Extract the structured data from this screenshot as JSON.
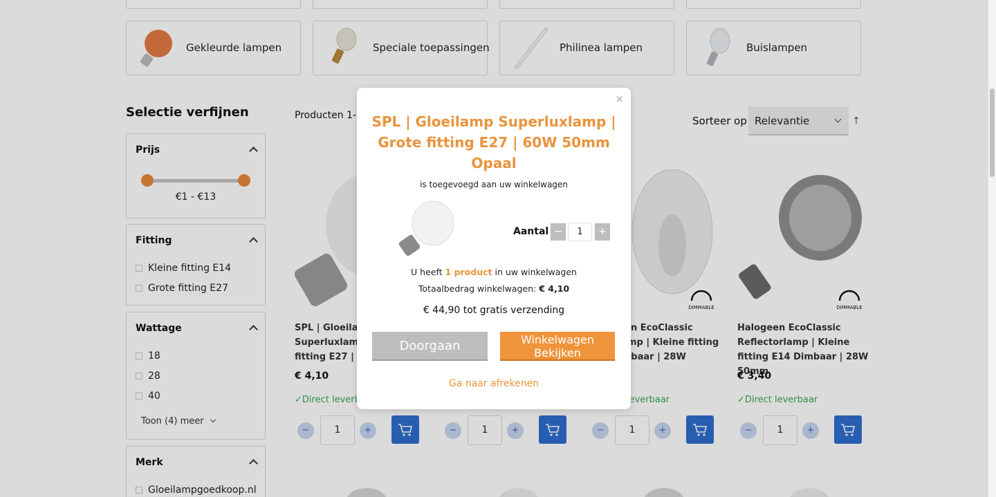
{
  "categories_top_partial": [
    "",
    "",
    "",
    ""
  ],
  "categories": [
    {
      "label": "Gekleurde lampen",
      "icon": "orange-bulb-icon"
    },
    {
      "label": "Speciale toepassingen",
      "icon": "small-bulb-icon"
    },
    {
      "label": "Philinea lampen",
      "icon": "tube-lamp-icon"
    },
    {
      "label": "Buislampen",
      "icon": "tube-bulb-icon"
    }
  ],
  "sidebar": {
    "title": "Selectie verfijnen",
    "price": {
      "title": "Prijs",
      "range_text": "€1 - €13"
    },
    "fitting": {
      "title": "Fitting",
      "options": [
        "Kleine fitting E14",
        "Grote fitting E27"
      ]
    },
    "wattage": {
      "title": "Wattage",
      "options": [
        "18",
        "28",
        "40"
      ],
      "more_prefix": "Toon (",
      "more_count": "4",
      "more_suffix": ") meer"
    },
    "merk": {
      "title": "Merk",
      "options": [
        "Gloeilampgoedkoop.nl"
      ]
    }
  },
  "listing": {
    "count_text": "Producten 1-1",
    "sort_label": "Sorteer op",
    "sort_value": "Relevantie",
    "sort_dir_icon": "arrow-up-icon"
  },
  "products": [
    {
      "title": "SPL | Gloeilamp Superluxlamp | Grote fitting E27 | 60W 50mm",
      "price": "€ 4,10",
      "stock": "Direct leverbaar",
      "qty": "1"
    },
    {
      "title": "",
      "price": "",
      "stock": "",
      "qty": "1"
    },
    {
      "title": "Halogeen EcoClassic Kaarslamp | Kleine fitting E14 Dimbaar | 28W",
      "price": "",
      "stock": "Direct leverbaar",
      "qty": "1",
      "dimmable": "DIMMABLE"
    },
    {
      "title": "Halogeen EcoClassic Reflectorlamp | Kleine fitting E14 Dimbaar | 28W 50mm",
      "price": "€ 3,40",
      "stock": "Direct leverbaar",
      "qty": "1",
      "dimmable": "DIMMABLE"
    }
  ],
  "modal": {
    "close": "×",
    "title": "SPL | Gloeilamp Superluxlamp | Grote fitting E27 | 60W 50mm Opaal",
    "added_text": "is toegevoegd aan uw winkelwagen",
    "qty_label": "Aantal",
    "qty_value": "1",
    "minus": "−",
    "plus": "+",
    "cart_line_prefix": "U heeft ",
    "cart_line_count": "1 product",
    "cart_line_suffix": " in uw winkelwagen",
    "total_label": "Totaalbedrag winkelwagen: ",
    "total_value": "€ 4,10",
    "free_shipping": "€ 44,90 tot gratis verzending",
    "continue_button": "Doorgaan",
    "view_cart_button": "Winkelwagen Bekijken",
    "checkout_link": "Ga naar afrekenen"
  },
  "colors": {
    "accent": "#e8943c",
    "cart_button": "#2f6ecf",
    "stock_green": "#3aa64f"
  }
}
